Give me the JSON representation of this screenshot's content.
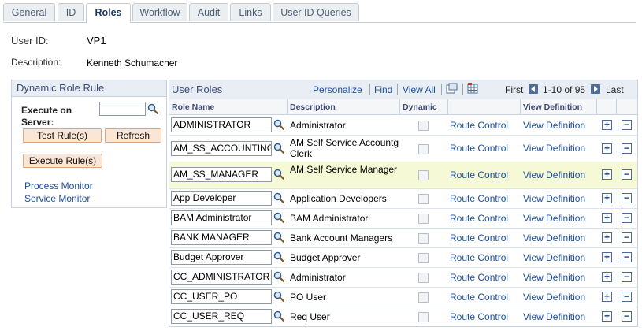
{
  "tabs": [
    {
      "label": "General"
    },
    {
      "label": "ID"
    },
    {
      "label": "Roles"
    },
    {
      "label": "Workflow"
    },
    {
      "label": "Audit"
    },
    {
      "label": "Links"
    },
    {
      "label": "User ID Queries"
    }
  ],
  "header": {
    "user_id_label": "User ID:",
    "user_id_value": "VP1",
    "description_label": "Description:",
    "description_value": "Kenneth Schumacher"
  },
  "dynamic_panel": {
    "title": "Dynamic Role Rule",
    "execute_on_server_label": "Execute on Server:",
    "test_rules_button": "Test Rule(s)",
    "refresh_button": "Refresh",
    "execute_rules_button": "Execute Rule(s)",
    "process_monitor_link": "Process Monitor",
    "service_monitor_link": "Service Monitor"
  },
  "grid": {
    "title": "User Roles",
    "personalize": "Personalize",
    "find": "Find",
    "view_all": "View All",
    "first": "First",
    "range": "1-10 of 95",
    "last": "Last",
    "columns": {
      "role_name": "Role Name",
      "description": "Description",
      "dynamic": "Dynamic",
      "view_definition": "View Definition"
    },
    "rows": [
      {
        "role": "ADMINISTRATOR",
        "description": "Administrator",
        "route": "Route Control",
        "view": "View Definition"
      },
      {
        "role": "AM_SS_ACCOUNTING",
        "description": "AM Self Service Accountg Clerk",
        "route": "Route Control",
        "view": "View Definition"
      },
      {
        "role": "AM_SS_MANAGER",
        "description": "AM Self Service Manager",
        "route": "Route Control",
        "view": "View Definition"
      },
      {
        "role": "App Developer",
        "description": "Application Developers",
        "route": "Route Control",
        "view": "View Definition"
      },
      {
        "role": "BAM Administrator",
        "description": "BAM Administrator",
        "route": "Route Control",
        "view": "View Definition"
      },
      {
        "role": "BANK MANAGER",
        "description": "Bank Account Managers",
        "route": "Route Control",
        "view": "View Definition"
      },
      {
        "role": "Budget Approver",
        "description": "Budget Approver",
        "route": "Route Control",
        "view": "View Definition"
      },
      {
        "role": "CC_ADMINISTRATOR",
        "description": "Administrator",
        "route": "Route Control",
        "view": "View Definition"
      },
      {
        "role": "CC_USER_PO",
        "description": "PO User",
        "route": "Route Control",
        "view": "View Definition"
      },
      {
        "role": "CC_USER_REQ",
        "description": "Req User",
        "route": "Route Control",
        "view": "View Definition"
      }
    ],
    "plus_symbol": "+",
    "minus_symbol": "−"
  },
  "colors": {
    "link": "#1d4f9c",
    "header_bg": "#e9eef4",
    "highlight_row": "#f6f9d6",
    "button_bg": "#fbe6d5"
  }
}
